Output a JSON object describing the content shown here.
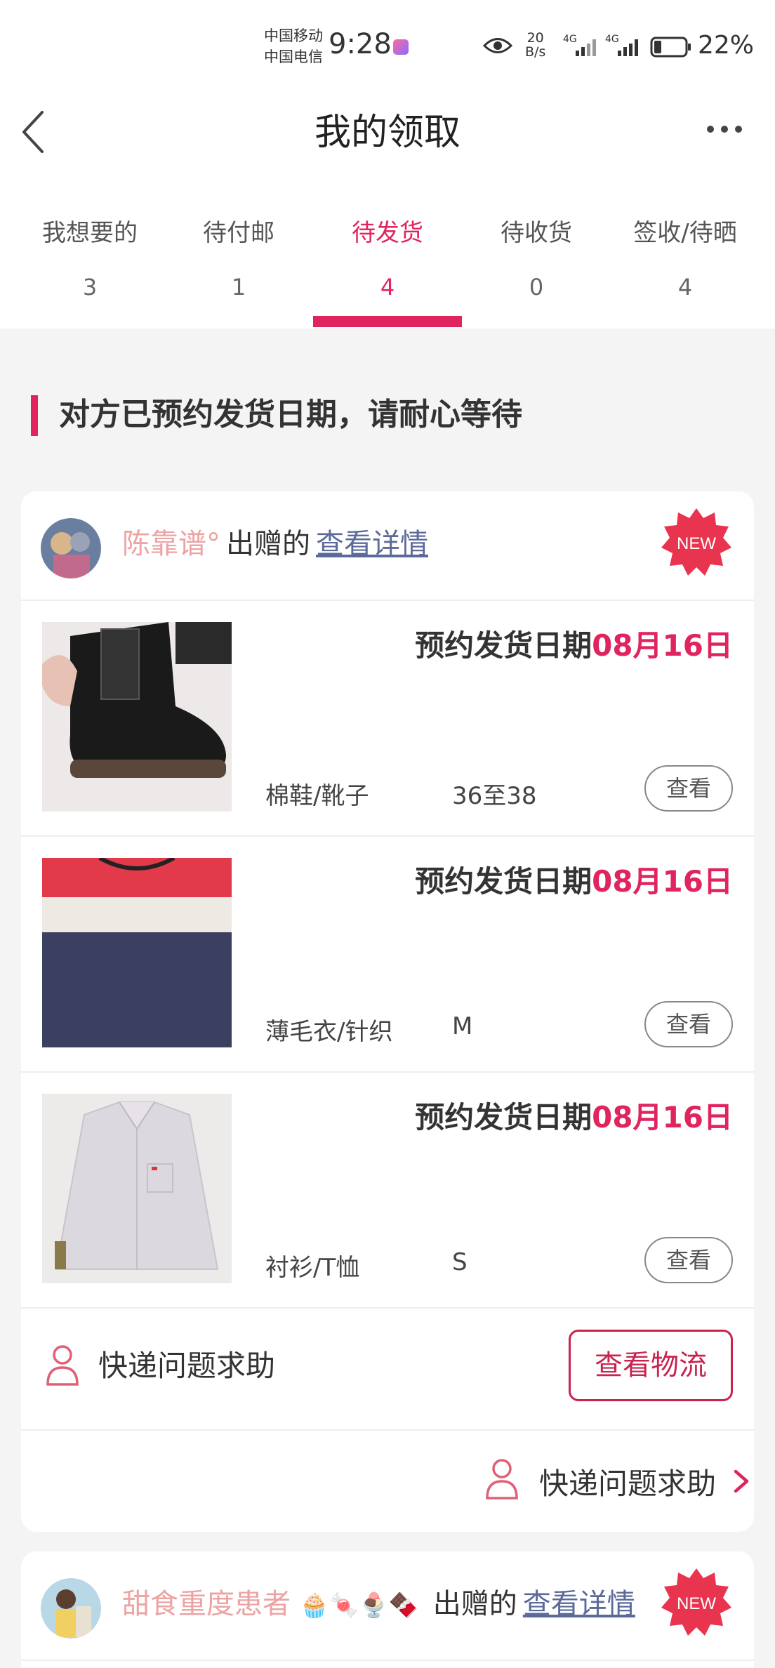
{
  "status_bar": {
    "carrier_1": "中国移动",
    "carrier_2": "中国电信",
    "time": "9:28",
    "net_speed_value": "20",
    "net_speed_unit": "B/s",
    "signal_1": "4G",
    "signal_2": "4G",
    "battery": "22%"
  },
  "nav": {
    "title": "我的领取",
    "back_icon": "chevron-left-icon",
    "more_icon": "more-horizontal-icon"
  },
  "tabs": [
    {
      "label": "我想要的",
      "count": "3",
      "active": false
    },
    {
      "label": "待付邮",
      "count": "1",
      "active": false
    },
    {
      "label": "待发货",
      "count": "4",
      "active": true
    },
    {
      "label": "待收货",
      "count": "0",
      "active": false
    },
    {
      "label": "签收/待晒",
      "count": "4",
      "active": false
    }
  ],
  "notice": "对方已预约发货日期，请耐心等待",
  "colors": {
    "accent": "#e0245e",
    "giver_name": "#eea3a3",
    "link": "#5b6a99",
    "background": "#f4f4f4"
  },
  "cards": [
    {
      "giver": "陈靠谱°",
      "verb": "出赠的",
      "details_link": "查看详情",
      "badge": "NEW",
      "items": [
        {
          "date_label": "预约发货日期",
          "date": "08月16日",
          "category": "棉鞋/靴子",
          "size": "36至38",
          "view": "查看"
        },
        {
          "date_label": "预约发货日期",
          "date": "08月16日",
          "category": "薄毛衣/针织",
          "size": "M",
          "view": "查看"
        },
        {
          "date_label": "预约发货日期",
          "date": "08月16日",
          "category": "衬衫/T恤",
          "size": "S",
          "view": "查看"
        }
      ],
      "help_text": "快递问题求助",
      "logistics_button": "查看物流",
      "help_link": "快递问题求助"
    },
    {
      "giver": "甜食重度患者",
      "giver_emoji": "🧁🍬🍨🍫",
      "verb": "出赠的",
      "details_link": "查看详情",
      "badge": "NEW"
    }
  ]
}
